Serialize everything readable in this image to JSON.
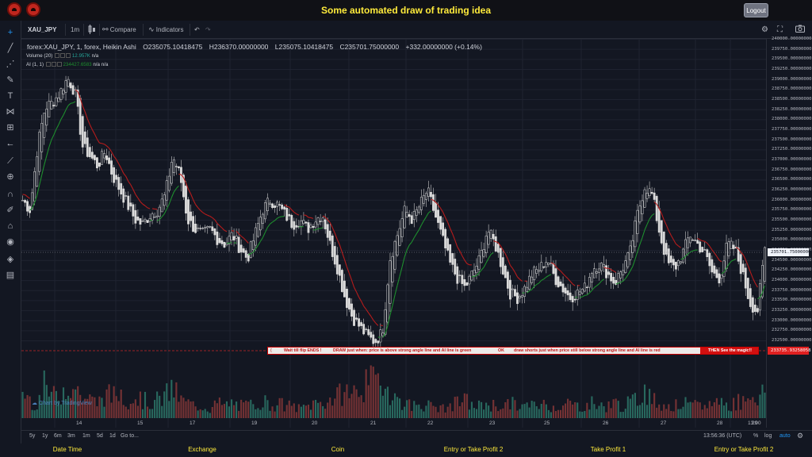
{
  "app": {
    "title": "Some automated draw of trading idea",
    "logout_label": "Logout"
  },
  "toolbar": {
    "symbol": "XAU_JPY",
    "interval": "1m",
    "compare_label": "Compare",
    "indicators_label": "Indicators"
  },
  "legend": {
    "title": "forex:XAU_JPY, 1, forex, Heikin Ashi",
    "open": "O235075.10418475",
    "high": "H236370.00000000",
    "low": "L235075.10418475",
    "close": "C235701.75000000",
    "change": "+332.00000000 (+0.14%)",
    "volume_label": "Volume (20)",
    "volume_value": "12.957K",
    "volume_na": "n/a",
    "ai_label": "AI (1, 1)",
    "ai_value": "234427.6583",
    "ai_na1": "n/a",
    "ai_na2": "n/a"
  },
  "price_axis": {
    "ticks": [
      "240000.00000000",
      "239750.00000000",
      "239500.00000000",
      "239250.00000000",
      "239000.00000000",
      "238750.00000000",
      "238500.00000000",
      "238250.00000000",
      "238000.00000000",
      "237750.00000000",
      "237500.00000000",
      "237250.00000000",
      "237000.00000000",
      "236750.00000000",
      "236500.00000000",
      "236250.00000000",
      "236000.00000000",
      "235750.00000000",
      "235500.00000000",
      "235250.00000000",
      "235000.00000000",
      "234750.00000000",
      "234500.00000000",
      "234250.00000000",
      "234000.00000000",
      "233750.00000000",
      "233500.00000000",
      "233250.00000000",
      "233000.00000000",
      "232750.00000000",
      "232500.00000000"
    ],
    "current_price": "235701.75000000",
    "highlight_price": "233735.93258058"
  },
  "time_axis": {
    "ticks": [
      "14",
      "15",
      "17",
      "19",
      "20",
      "21",
      "22",
      "23",
      "25",
      "26",
      "27",
      "28",
      "29",
      "13:00"
    ]
  },
  "strategy": {
    "text1": "Wait till flip ENDS  !",
    "text2": "DRAW just when:  price is above strong angle line and AI line is green",
    "text3": "OK",
    "text4": "draw shorts just when price still below strong angle line and AI line is red",
    "button": "THEN See the magic!!"
  },
  "watermark": "Chart by TradingView",
  "ranges": {
    "items": [
      "5y",
      "1y",
      "6m",
      "3m",
      "1m",
      "5d",
      "1d"
    ],
    "goto": "Go to...",
    "clock": "13:56:36 (UTC)",
    "percent": "%",
    "log": "log",
    "auto": "auto"
  },
  "footer": {
    "items": [
      "Date Time",
      "Exchange",
      "Coin",
      "Entry or Take Profit 2",
      "Take Profit 1",
      "Entry or Take Profit 2"
    ]
  },
  "colors": {
    "background": "#131722",
    "up": "#26a69a",
    "down": "#ef5350",
    "ai_green": "#1e8e2e",
    "ai_red": "#b71c1c",
    "title_yellow": "#ffeb3b"
  },
  "chart_data": {
    "type": "candlestick",
    "chart_style": "Heikin Ashi",
    "price_range": [
      232400,
      240000
    ],
    "grid": true,
    "close_path": [
      236700,
      236500,
      237800,
      238600,
      238700,
      238900,
      239200,
      238900,
      237800,
      237600,
      237400,
      237700,
      237200,
      236900,
      236600,
      236300,
      236200,
      236400,
      236500,
      236800,
      237600,
      237200,
      236300,
      236100,
      236000,
      236100,
      235900,
      235800,
      236000,
      235700,
      235500,
      236000,
      236500,
      236700,
      236600,
      236400,
      236200,
      236300,
      236100,
      236300,
      236400,
      235800,
      235300,
      234700,
      234300,
      234100,
      233900,
      233800,
      234000,
      235500,
      236000,
      236500,
      236300,
      236600,
      236900,
      236400,
      235900,
      235400,
      235100,
      234900,
      235200,
      235500,
      236100,
      235800,
      235300,
      234800,
      234700,
      234900,
      235200,
      235300,
      235500,
      235100,
      234900,
      234700,
      234800,
      234900,
      235300,
      235400,
      235200,
      235000,
      235300,
      235600,
      236400,
      237000,
      236800,
      236000,
      235400,
      235300,
      235600,
      236000,
      235800,
      235600,
      235200,
      235100,
      235800,
      235700,
      235200,
      234600,
      234400,
      235700
    ],
    "volume_path": [
      0.45,
      0.3,
      0.25,
      0.55,
      0.35,
      0.4,
      0.6,
      0.5,
      0.35,
      0.3,
      0.25,
      0.4,
      0.35,
      0.45,
      0.3,
      0.35,
      0.3,
      0.25,
      0.3,
      0.35,
      0.5,
      0.3,
      0.25,
      0.2,
      0.2,
      0.15,
      0.25,
      0.2,
      0.25,
      0.2,
      0.2,
      0.25,
      0.3,
      0.2,
      0.25,
      0.2,
      0.2,
      0.15,
      0.2,
      0.25,
      0.25,
      0.3,
      0.35,
      0.45,
      0.4,
      0.5,
      0.55,
      0.6,
      0.65,
      0.45,
      0.3,
      0.25,
      0.2,
      0.25,
      0.2,
      0.2,
      0.15,
      0.2,
      0.25,
      0.3,
      0.2,
      0.2,
      0.25,
      0.2,
      0.2,
      0.25,
      0.2,
      0.2,
      0.2,
      0.25,
      0.2,
      0.2,
      0.2,
      0.25,
      0.2,
      0.2,
      0.25,
      0.2,
      0.2,
      0.25,
      0.2,
      0.25,
      0.3,
      0.5,
      0.3,
      0.25,
      0.2,
      0.2,
      0.25,
      0.2,
      0.2,
      0.2,
      0.25,
      0.3,
      0.2,
      0.25,
      0.3,
      0.4,
      0.35,
      0.45
    ]
  }
}
